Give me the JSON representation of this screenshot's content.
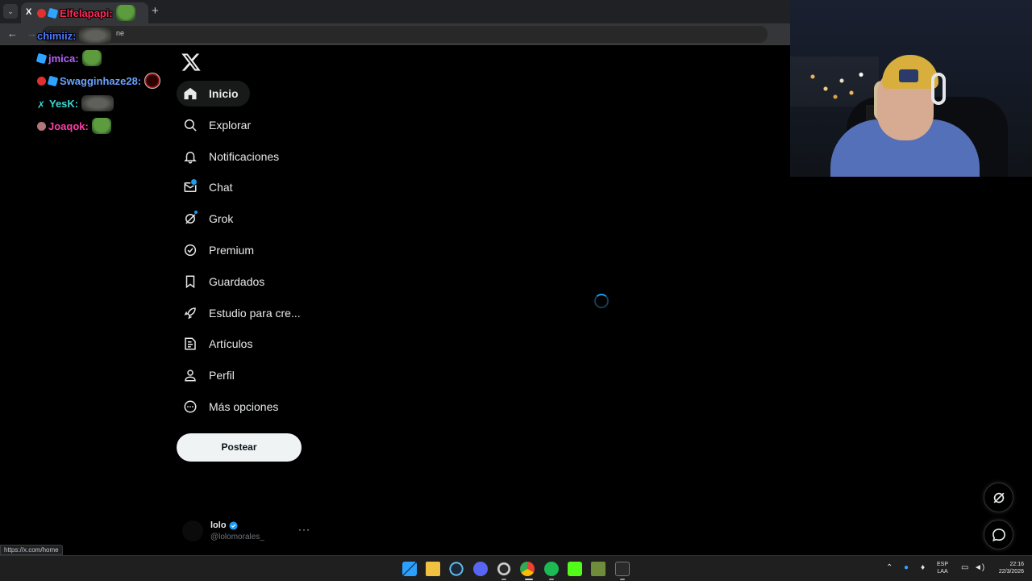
{
  "browser": {
    "tab_favicon": "X",
    "tab_dropdown": "⌄",
    "new_tab": "+",
    "back": "←",
    "forward": "→",
    "addr_fragment": "ne"
  },
  "chat": [
    {
      "user": "Elfelapapi:",
      "color": "#ff2a5a",
      "badges": [
        "red",
        "blue"
      ],
      "emote": "pepe"
    },
    {
      "user": "chimiiz:",
      "color": "#4f7cff",
      "badges": [],
      "emote": "gray"
    },
    {
      "user": "jmica:",
      "color": "#b860ff",
      "badges": [
        "blue"
      ],
      "emote": "pepe"
    },
    {
      "user": "Swagginhaze28:",
      "color": "#6aa2ff",
      "badges": [
        "red",
        "blue"
      ],
      "emote": "red"
    },
    {
      "user": "YesK:",
      "color": "#3dd6d0",
      "badges": [
        "sword"
      ],
      "emote": "gray"
    },
    {
      "user": "Joaqok:",
      "color": "#ff3ca8",
      "badges": [
        "gray"
      ],
      "emote": "pepe"
    }
  ],
  "sidebar": {
    "items": [
      {
        "label": "Inicio",
        "icon": "home-icon"
      },
      {
        "label": "Explorar",
        "icon": "search-icon"
      },
      {
        "label": "Notificaciones",
        "icon": "bell-icon"
      },
      {
        "label": "Chat",
        "icon": "mail-icon"
      },
      {
        "label": "Grok",
        "icon": "grok-icon"
      },
      {
        "label": "Premium",
        "icon": "premium-icon"
      },
      {
        "label": "Guardados",
        "icon": "bookmark-icon"
      },
      {
        "label": "Estudio para cre...",
        "icon": "rocket-icon"
      },
      {
        "label": "Artículos",
        "icon": "article-icon"
      },
      {
        "label": "Perfil",
        "icon": "person-icon"
      },
      {
        "label": "Más opciones",
        "icon": "more-circle-icon"
      }
    ],
    "post_label": "Postear",
    "account": {
      "name": "lolo",
      "handle": "@lolomorales_",
      "more": "···"
    }
  },
  "status_url": "https://x.com/home",
  "taskbar": {
    "lang": "ESP",
    "layout": "LAA",
    "time": "22:16",
    "date": "22/3/2026"
  },
  "colors": {
    "accent": "#1d9bf0",
    "background": "#000000",
    "text": "#e7e9ea"
  }
}
